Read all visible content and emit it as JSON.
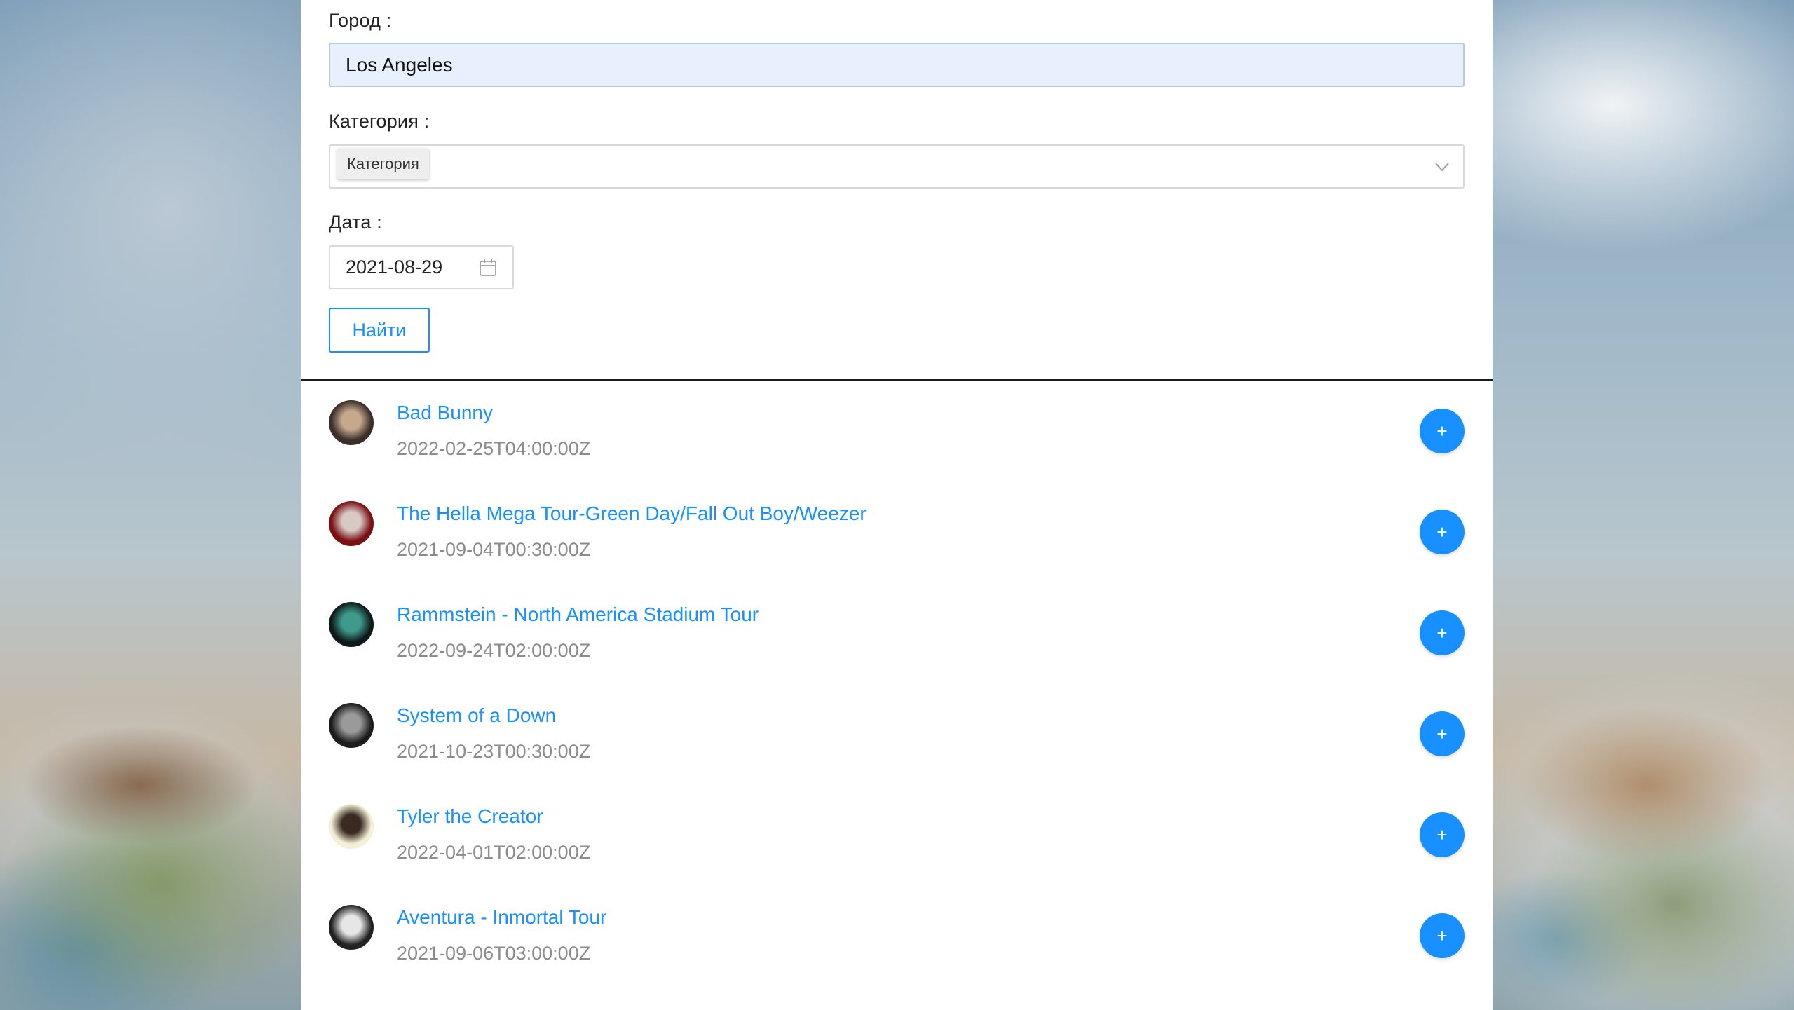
{
  "form": {
    "city_label": "Город :",
    "city_value": "Los Angeles",
    "category_label": "Категория :",
    "category_tag": "Категория",
    "date_label": "Дата :",
    "date_value": "2021-08-29",
    "find_label": "Найти"
  },
  "events": [
    {
      "title": "Bad Bunny",
      "date": "2022-02-25T04:00:00Z",
      "add_label": "+",
      "avatar_colors": [
        "#3b2f2a",
        "#c6a88c"
      ]
    },
    {
      "title": "The Hella Mega Tour-Green Day/Fall Out Boy/Weezer",
      "date": "2021-09-04T00:30:00Z",
      "add_label": "+",
      "avatar_colors": [
        "#7a0f14",
        "#d8c9c4"
      ]
    },
    {
      "title": "Rammstein - North America Stadium Tour",
      "date": "2022-09-24T02:00:00Z",
      "add_label": "+",
      "avatar_colors": [
        "#0e1a1a",
        "#3f9a8c"
      ]
    },
    {
      "title": "System of a Down",
      "date": "2021-10-23T00:30:00Z",
      "add_label": "+",
      "avatar_colors": [
        "#1c1c1c",
        "#9a9a9a"
      ]
    },
    {
      "title": "Tyler the Creator",
      "date": "2022-04-01T02:00:00Z",
      "add_label": "+",
      "avatar_colors": [
        "#f4efd6",
        "#3a2a22"
      ]
    },
    {
      "title": "Aventura - Inmortal Tour",
      "date": "2021-09-06T03:00:00Z",
      "add_label": "+",
      "avatar_colors": [
        "#222222",
        "#e6e6e6"
      ]
    }
  ],
  "colors": {
    "accent": "#1890ff",
    "input_autofill": "#e8f0fe",
    "secondary_text": "#8c8c8c"
  },
  "icons": {
    "dropdown": "chevron-down-icon",
    "date": "calendar-icon",
    "add": "plus-icon"
  }
}
